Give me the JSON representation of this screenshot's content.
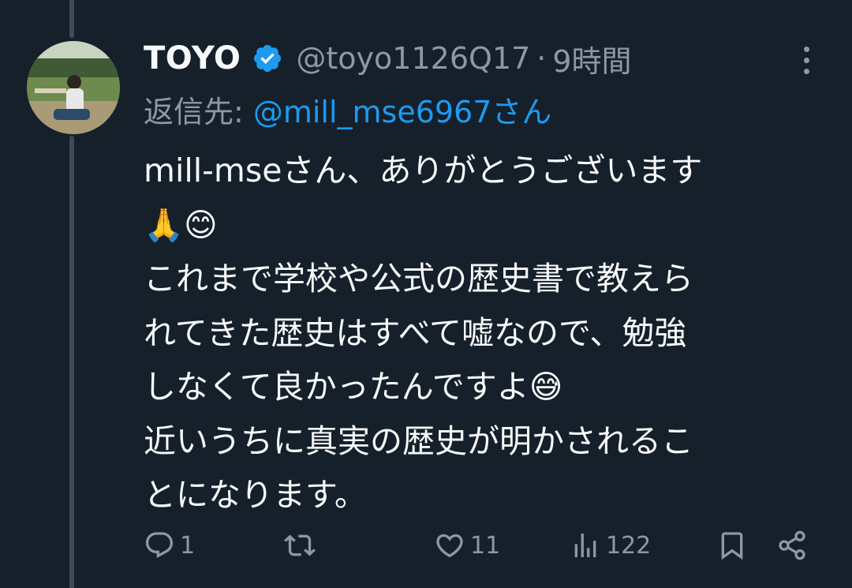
{
  "tweet": {
    "author_name": "TOYO",
    "handle": "@toyo1126Q17",
    "separator": "·",
    "time": "9時間",
    "reply_prefix": "返信先:",
    "reply_target": "@mill_mse6967さん",
    "body_lines": [
      "mill-mseさん、ありがとうございます",
      "🙏😊",
      "これまで学校や公式の歴史書で教えら",
      "れてきた歴史はすべて嘘なので、勉強",
      "しなくて良かったんですよ😅",
      "近いうちに真実の歴史が明かされるこ",
      "とになります。"
    ]
  },
  "actions": {
    "reply_count": "1",
    "retweet_count": "",
    "like_count": "11",
    "views_count": "122"
  },
  "icons": {
    "verified": "verified-badge-icon",
    "more": "more-icon",
    "reply": "reply-icon",
    "retweet": "retweet-icon",
    "like": "like-icon",
    "views": "views-icon",
    "bookmark": "bookmark-icon",
    "share": "share-icon"
  },
  "colors": {
    "background": "#15202b",
    "primary_text": "#f7f9f9",
    "secondary_text": "#8b98a5",
    "accent": "#1d9bf0",
    "thread_line": "#3d4b58"
  }
}
